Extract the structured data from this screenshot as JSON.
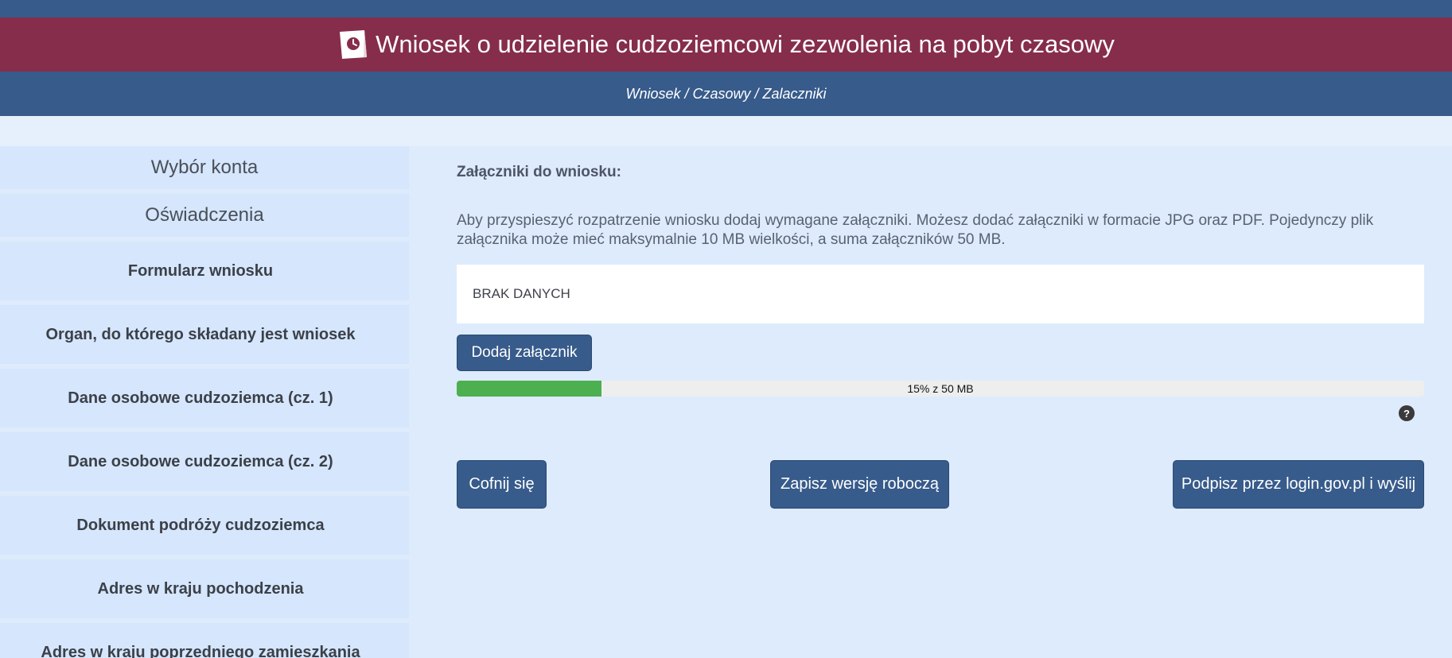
{
  "header": {
    "title": "Wniosek o udzielenie cudzoziemcowi zezwolenia na pobyt czasowy",
    "breadcrumb": "Wniosek / Czasowy / Zalaczniki",
    "icon": "document-clock-icon"
  },
  "sidebar": {
    "items": [
      {
        "label": "Wybór konta"
      },
      {
        "label": "Oświadczenia"
      },
      {
        "label": "Formularz wniosku"
      },
      {
        "label": "Organ, do którego składany jest wniosek"
      },
      {
        "label": "Dane osobowe cudzoziemca (cz. 1)"
      },
      {
        "label": "Dane osobowe cudzoziemca (cz. 2)"
      },
      {
        "label": "Dokument podróży cudzoziemca"
      },
      {
        "label": "Adres w kraju pochodzenia"
      },
      {
        "label": "Adres w kraju poprzedniego zamieszkania"
      }
    ]
  },
  "main": {
    "section_title": "Załączniki do wniosku:",
    "info_text": "Aby przyspieszyć rozpatrzenie wniosku dodaj wymagane załączniki. Możesz dodać załączniki w formacie JPG oraz PDF. Pojedynczy plik załącznika może mieć maksymalnie 10 MB wielkości, a suma załączników 50 MB.",
    "empty_text": "BRAK DANYCH",
    "add_button": "Dodaj załącznik",
    "progress": {
      "fraction": 0.15,
      "label": "15% z 50 MB"
    },
    "help_label": "?",
    "back_button": "Cofnij się",
    "draft_button": "Zapisz wersję roboczą",
    "sign_button": "Podpisz przez login.gov.pl i wyślij"
  },
  "colors": {
    "header_blue": "#375b8b",
    "title_bar": "#862d4c",
    "background": "#ddebfc",
    "sidebar_item": "#d5e6fd",
    "progress_fill": "#4caf50"
  }
}
